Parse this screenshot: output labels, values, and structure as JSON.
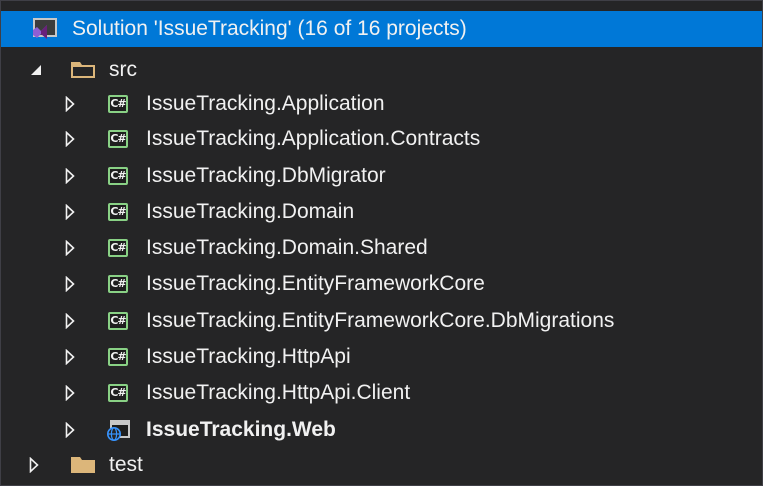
{
  "solution": {
    "label": "Solution 'IssueTracking' (16 of 16 projects)",
    "icon": "visual-studio-solution-icon"
  },
  "folders": [
    {
      "label": "src",
      "state": "expanded",
      "icon": "folder-open-icon"
    },
    {
      "label": "test",
      "state": "collapsed",
      "icon": "folder-icon"
    }
  ],
  "projects": [
    {
      "label": "IssueTracking.Application",
      "icon": "csharp-project-icon",
      "glyph": "C#"
    },
    {
      "label": "IssueTracking.Application.Contracts",
      "icon": "csharp-project-icon",
      "glyph": "C#"
    },
    {
      "label": "IssueTracking.DbMigrator",
      "icon": "csharp-project-icon",
      "glyph": "C#"
    },
    {
      "label": "IssueTracking.Domain",
      "icon": "csharp-project-icon",
      "glyph": "C#"
    },
    {
      "label": "IssueTracking.Domain.Shared",
      "icon": "csharp-project-icon",
      "glyph": "C#"
    },
    {
      "label": "IssueTracking.EntityFrameworkCore",
      "icon": "csharp-project-icon",
      "glyph": "C#"
    },
    {
      "label": "IssueTracking.EntityFrameworkCore.DbMigrations",
      "icon": "csharp-project-icon",
      "glyph": "C#"
    },
    {
      "label": "IssueTracking.HttpApi",
      "icon": "csharp-project-icon",
      "glyph": "C#"
    },
    {
      "label": "IssueTracking.HttpApi.Client",
      "icon": "csharp-project-icon",
      "glyph": "C#"
    },
    {
      "label": "IssueTracking.Web",
      "icon": "web-project-icon",
      "bold": true
    }
  ],
  "colors": {
    "background": "#252526",
    "selection": "#0078d7",
    "text": "#f1f1f1",
    "csharp_accent": "#89d185",
    "folder": "#dcb67a",
    "web_accent": "#3794ff"
  }
}
